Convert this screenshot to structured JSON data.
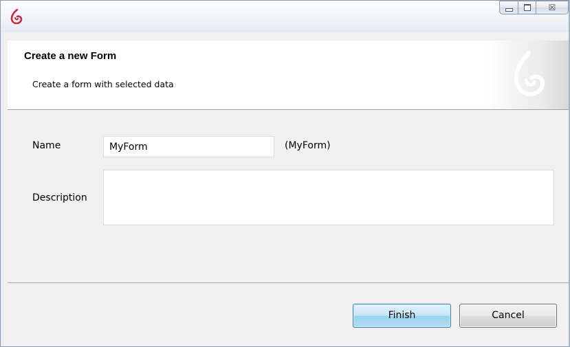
{
  "window": {
    "controls": {
      "minimize_icon": "minimize-icon",
      "maximize_icon": "maximize-icon",
      "close_glyph": "☒"
    }
  },
  "banner": {
    "title": "Create a new Form",
    "subtitle": "Create a form with selected data"
  },
  "form": {
    "name_label": "Name",
    "name_value": "MyForm",
    "name_hint": "(MyForm)",
    "description_label": "Description",
    "description_value": ""
  },
  "buttons": {
    "finish_label": "Finish",
    "cancel_label": "Cancel"
  },
  "colors": {
    "brand": "#c8283c",
    "finish_border": "#3c7fb1"
  }
}
